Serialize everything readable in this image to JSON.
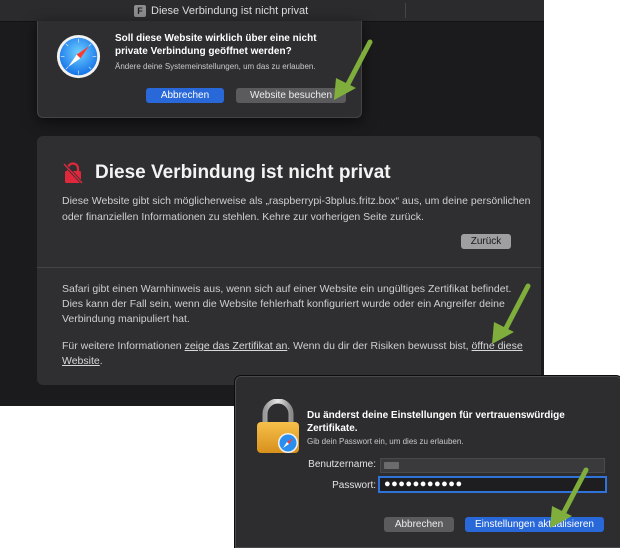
{
  "window": {
    "title": "Diese Verbindung ist nicht privat",
    "favicon_letter": "F"
  },
  "alert": {
    "title": "Soll diese Website wirklich über eine nicht private Verbindung geöffnet werden?",
    "subtitle": "Ändere deine Systemeinstellungen, um das zu erlauben.",
    "cancel_label": "Abbrechen",
    "visit_label": "Website besuchen",
    "icon": "safari-compass-icon"
  },
  "warning": {
    "icon": "broken-lock-icon",
    "title": "Diese Verbindung ist nicht privat",
    "paragraph1": "Diese Website gibt sich möglicherweise als „raspberrypi-3bplus.fritz.box“ aus, um deine persönlichen oder finanziellen Informationen zu stehlen. Kehre zur vorherigen Seite zurück.",
    "back_label": "Zurück",
    "paragraph2": "Safari gibt einen Warnhinweis aus, wenn sich auf einer Website ein ungültiges Zertifikat befindet. Dies kann der Fall sein, wenn die Website fehlerhaft konfiguriert wurde oder ein Angreifer deine Verbindung manipuliert hat.",
    "info_prefix": "Für weitere Informationen ",
    "info_link_cert": "zeige das Zertifikat an",
    "info_middle": ". Wenn du dir der Risiken bewusst bist, ",
    "info_link_open": "öffne diese Website",
    "info_suffix": "."
  },
  "auth": {
    "icon": "lock-icon",
    "title": "Du änderst deine Einstellungen für vertrauenswürdige Zertifikate.",
    "subtitle": "Gib dein Passwort ein, um dies zu erlauben.",
    "username_label": "Benutzername:",
    "password_label": "Passwort:",
    "password_mask": "●●●●●●●●●●●",
    "cancel_label": "Abbrechen",
    "update_label": "Einstellungen aktualisieren"
  },
  "colors": {
    "accent_blue": "#2868d9",
    "arrow_green": "#7fae3c",
    "warning_red": "#e0283c"
  }
}
